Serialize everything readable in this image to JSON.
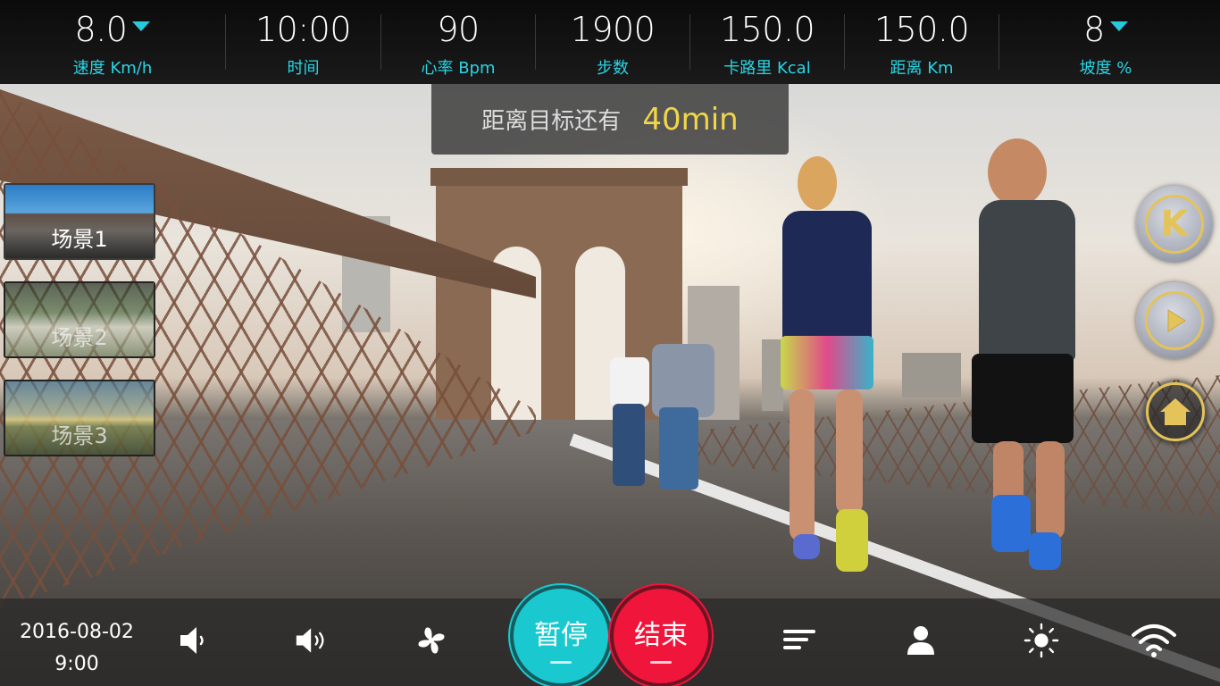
{
  "stats": [
    {
      "value": "8.0",
      "label": "速度 Km/h",
      "dropdown": true
    },
    {
      "value": "10:00",
      "label": "时间",
      "dropdown": false
    },
    {
      "value": "90",
      "label": "心率 Bpm",
      "dropdown": false
    },
    {
      "value": "1900",
      "label": "步数",
      "dropdown": false
    },
    {
      "value": "150.0",
      "label": "卡路里 Kcal",
      "dropdown": false
    },
    {
      "value": "150.0",
      "label": "距离 Km",
      "dropdown": false
    },
    {
      "value": "8",
      "label": "坡度 %",
      "dropdown": true
    }
  ],
  "goal": {
    "text": "距离目标还有",
    "value": "40min"
  },
  "scenes": [
    {
      "label": "场景1",
      "selected": true
    },
    {
      "label": "场景2",
      "selected": false
    },
    {
      "label": "场景3",
      "selected": false
    }
  ],
  "side_buttons": {
    "k_label": "K"
  },
  "bottom": {
    "date": "2016-08-02",
    "time": "9:00",
    "pause_label": "暂停",
    "end_label": "结束"
  },
  "colors": {
    "accent": "#19c9cf",
    "danger": "#f0153b",
    "gold": "#e4c35a",
    "goal_value": "#f1d54a",
    "label": "#2ad4e4"
  },
  "icons": [
    "volume-down-icon",
    "volume-up-icon",
    "fan-icon",
    "menu-bars-icon",
    "user-icon",
    "brightness-icon",
    "wifi-icon",
    "k-icon",
    "play-icon",
    "home-icon"
  ]
}
